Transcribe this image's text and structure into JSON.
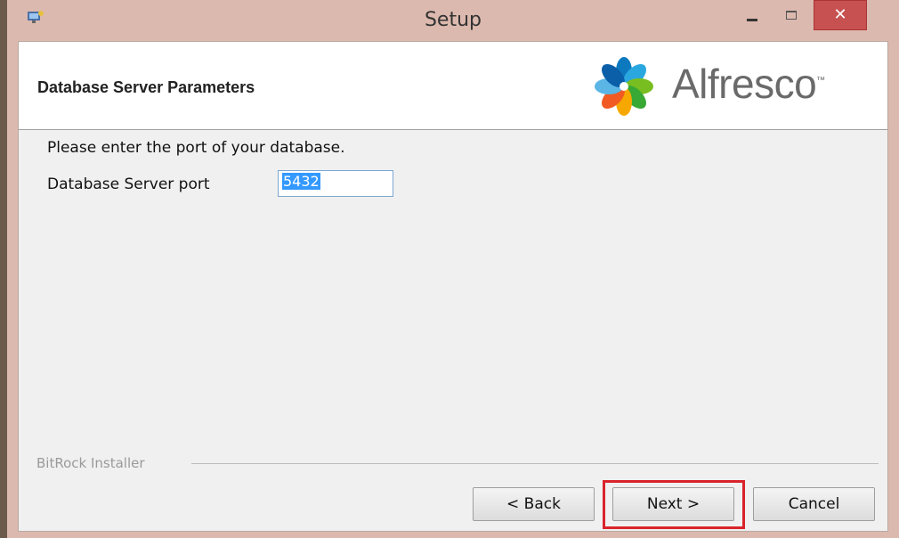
{
  "window": {
    "title": "Setup",
    "controls": [
      "minimize-icon",
      "maximize-icon",
      "close-icon"
    ],
    "close_glyph": "✕"
  },
  "header": {
    "title": "Database Server Parameters",
    "logo_text": "Alfresco",
    "logo_mark": "™"
  },
  "form": {
    "prompt": "Please enter the port of your database.",
    "port_label": "Database Server port",
    "port_value": "5432"
  },
  "footer": {
    "brand": "BitRock Installer",
    "back_label": "< Back",
    "next_label": "Next >",
    "cancel_label": "Cancel"
  },
  "colors": {
    "highlight": "#d9232a",
    "close_button": "#c75050",
    "selection": "#3399ff"
  }
}
